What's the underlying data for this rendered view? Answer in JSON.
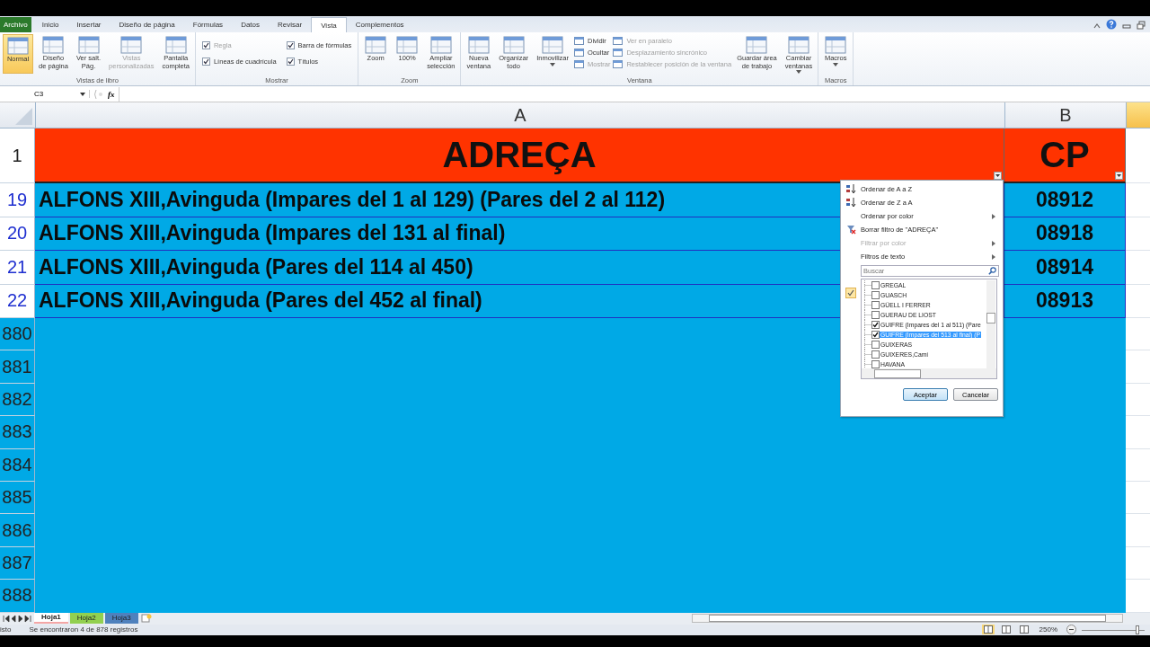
{
  "ribbon_tabs": [
    {
      "label": "Archivo",
      "kind": "file",
      "selected": false
    },
    {
      "label": "Inicio",
      "kind": "tab",
      "selected": false
    },
    {
      "label": "Insertar",
      "kind": "tab",
      "selected": false
    },
    {
      "label": "Diseño de página",
      "kind": "tab",
      "selected": false
    },
    {
      "label": "Fórmulas",
      "kind": "tab",
      "selected": false
    },
    {
      "label": "Datos",
      "kind": "tab",
      "selected": false
    },
    {
      "label": "Revisar",
      "kind": "tab",
      "selected": false
    },
    {
      "label": "Vista",
      "kind": "tab",
      "selected": true
    },
    {
      "label": "Complementos",
      "kind": "tab",
      "selected": false
    }
  ],
  "ribbon_groups": [
    {
      "label": "Vistas de libro",
      "items": [
        {
          "kind": "large",
          "label": "Normal",
          "selected": true,
          "disabled": false,
          "dropdown": false
        },
        {
          "kind": "large",
          "label": "Diseño\nde página",
          "selected": false,
          "disabled": false,
          "dropdown": false
        },
        {
          "kind": "large",
          "label": "Ver salt.\nPág.",
          "selected": false,
          "disabled": false,
          "dropdown": false
        },
        {
          "kind": "large",
          "label": "Vistas\npersonalizadas",
          "selected": false,
          "disabled": true,
          "dropdown": false
        },
        {
          "kind": "large",
          "label": "Pantalla\ncompleta",
          "selected": false,
          "disabled": false,
          "dropdown": false
        }
      ]
    },
    {
      "label": "Mostrar",
      "items": [
        {
          "kind": "check",
          "label": "Regla",
          "checked": true,
          "disabled": true
        },
        {
          "kind": "check",
          "label": "Líneas de cuadrícula",
          "checked": true,
          "disabled": false
        },
        {
          "kind": "check",
          "label": "Barra de fórmulas",
          "checked": true,
          "disabled": false
        },
        {
          "kind": "check",
          "label": "Títulos",
          "checked": true,
          "disabled": false
        }
      ]
    },
    {
      "label": "Zoom",
      "items": [
        {
          "kind": "large",
          "label": "Zoom",
          "selected": false,
          "disabled": false,
          "dropdown": false
        },
        {
          "kind": "large",
          "label": "100%",
          "selected": false,
          "disabled": false,
          "dropdown": false
        },
        {
          "kind": "large",
          "label": "Ampliar\nselección",
          "selected": false,
          "disabled": false,
          "dropdown": false
        }
      ]
    },
    {
      "label": "Ventana",
      "items": [
        {
          "kind": "large",
          "label": "Nueva\nventana",
          "selected": false,
          "disabled": false,
          "dropdown": false
        },
        {
          "kind": "large",
          "label": "Organizar\ntodo",
          "selected": false,
          "disabled": false,
          "dropdown": false
        },
        {
          "kind": "large",
          "label": "Inmovilizar",
          "selected": false,
          "disabled": false,
          "dropdown": true
        },
        {
          "kind": "small",
          "label": "Dividir",
          "disabled": false
        },
        {
          "kind": "small",
          "label": "Ocultar",
          "disabled": false
        },
        {
          "kind": "small",
          "label": "Mostrar",
          "disabled": true
        },
        {
          "kind": "small",
          "label": "Ver en paralelo",
          "disabled": true
        },
        {
          "kind": "small",
          "label": "Desplazamiento sincrónico",
          "disabled": true
        },
        {
          "kind": "small",
          "label": "Restablecer posición de la ventana",
          "disabled": true
        },
        {
          "kind": "large",
          "label": "Guardar área\nde trabajo",
          "selected": false,
          "disabled": false,
          "dropdown": false
        },
        {
          "kind": "large",
          "label": "Cambiar\nventanas",
          "selected": false,
          "disabled": false,
          "dropdown": true
        }
      ]
    },
    {
      "label": "Macros",
      "items": [
        {
          "kind": "large",
          "label": "Macros",
          "selected": false,
          "disabled": false,
          "dropdown": true
        }
      ]
    }
  ],
  "formula_bar": {
    "name_box": "C3",
    "fx": "fx"
  },
  "columns": [
    {
      "label": "A",
      "selected": false
    },
    {
      "label": "B",
      "selected": false
    },
    {
      "selected": true
    }
  ],
  "header_row": {
    "number": "1",
    "cells": [
      "ADREÇA",
      "CP"
    ]
  },
  "rows": [
    {
      "number": "19",
      "filtered": true,
      "cells": [
        "ALFONS XIII,Avinguda (Impares del 1 al 129) (Pares del 2 al 112)",
        "08912"
      ]
    },
    {
      "number": "20",
      "filtered": true,
      "cells": [
        "ALFONS XIII,Avinguda (Impares del 131 al final)",
        "08918"
      ]
    },
    {
      "number": "21",
      "filtered": true,
      "cells": [
        "ALFONS XIII,Avinguda (Pares del 114 al 450)",
        "08914"
      ]
    },
    {
      "number": "22",
      "filtered": true,
      "cells": [
        "ALFONS XIII,Avinguda (Pares del 452 al final)",
        "08913"
      ]
    }
  ],
  "empty_rows": [
    {
      "number": "880",
      "filtered": false
    },
    {
      "number": "881",
      "filtered": false
    },
    {
      "number": "882",
      "filtered": false
    },
    {
      "number": "883",
      "filtered": false
    },
    {
      "number": "884",
      "filtered": false
    },
    {
      "number": "885",
      "filtered": false
    },
    {
      "number": "886",
      "filtered": false
    },
    {
      "number": "887",
      "filtered": false
    },
    {
      "number": "888",
      "filtered": false
    }
  ],
  "filter_menu": {
    "items": [
      {
        "label": "Ordenar de A a Z",
        "kind": "sort-asc",
        "disabled": false,
        "submenu": false
      },
      {
        "label": "Ordenar de Z a A",
        "kind": "sort-desc",
        "disabled": false,
        "submenu": false
      },
      {
        "label": "Ordenar por color",
        "kind": "plain",
        "disabled": false,
        "submenu": true
      },
      {
        "label": "Borrar filtro de \"ADREÇA\"",
        "kind": "clear",
        "disabled": false,
        "submenu": false
      },
      {
        "label": "Filtrar por color",
        "kind": "plain",
        "disabled": true,
        "submenu": true
      },
      {
        "label": "Filtros de texto",
        "kind": "plain",
        "disabled": false,
        "submenu": true
      }
    ],
    "text_filter_applied": true,
    "search": {
      "placeholder": "Buscar"
    },
    "values": [
      {
        "label": "GREGAL",
        "checked": false,
        "selected": false
      },
      {
        "label": "GUASCH",
        "checked": false,
        "selected": false
      },
      {
        "label": "GÜELL I FERRER",
        "checked": false,
        "selected": false
      },
      {
        "label": "GUERAU DE LIOST",
        "checked": false,
        "selected": false
      },
      {
        "label": "GUIFRE (Impares del 1 al 511) (Pare",
        "checked": true,
        "selected": false
      },
      {
        "label": "GUIFRE (Impares del 513 al final) (P",
        "checked": true,
        "selected": true
      },
      {
        "label": "GUIXERAS",
        "checked": false,
        "selected": false
      },
      {
        "label": "GUIXERES,Camí",
        "checked": false,
        "selected": false
      },
      {
        "label": "HAVANA",
        "checked": false,
        "selected": false
      }
    ],
    "buttons": [
      "Aceptar",
      "Cancelar"
    ]
  },
  "sheet_tabs": [
    {
      "label": "Hoja1",
      "selected": true,
      "color": "#f4a6a6"
    },
    {
      "label": "Hoja2",
      "selected": false,
      "color": "#92d050"
    },
    {
      "label": "Hoja3",
      "selected": false,
      "color": "#4f81bd"
    }
  ],
  "status_bar": {
    "mode": "isto",
    "message": "Se encontraron 4 de 878 registros",
    "zoom": "250%",
    "zoom_slider": {
      "level": 0.85
    },
    "views": [
      {
        "selected": true
      },
      {
        "selected": false
      },
      {
        "selected": false
      }
    ]
  }
}
